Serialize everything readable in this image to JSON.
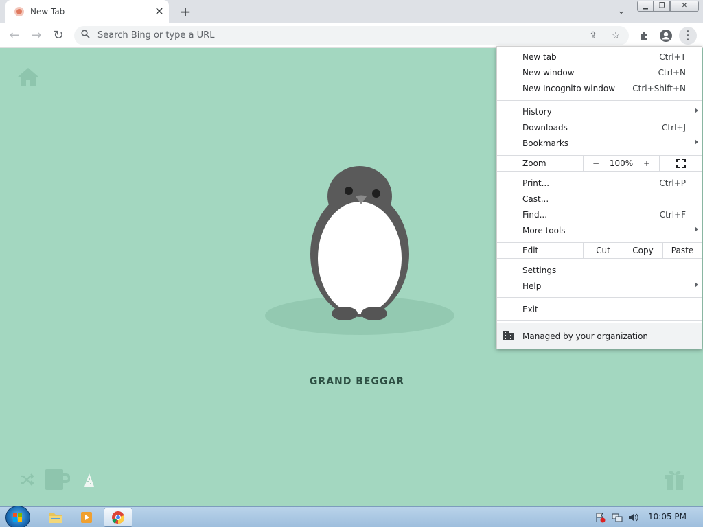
{
  "tab": {
    "title": "New Tab",
    "close": "✕"
  },
  "tabstrip": {
    "new_tab": "+",
    "search_tabs": "⌄"
  },
  "window": {
    "minimize": "▁",
    "maximize": "❐",
    "close": "✕"
  },
  "toolbar": {
    "back": "←",
    "forward": "→",
    "reload": "↻",
    "share": "⇪",
    "bookmark": "☆",
    "extensions": "✚",
    "menu": "⋮"
  },
  "omnibox": {
    "placeholder": "Search Bing or type a URL"
  },
  "ntp": {
    "caption": "GRAND BEGGAR"
  },
  "menu": {
    "new_tab": {
      "label": "New tab",
      "shortcut": "Ctrl+T"
    },
    "new_window": {
      "label": "New window",
      "shortcut": "Ctrl+N"
    },
    "incognito": {
      "label": "New Incognito window",
      "shortcut": "Ctrl+Shift+N"
    },
    "history": {
      "label": "History"
    },
    "downloads": {
      "label": "Downloads",
      "shortcut": "Ctrl+J"
    },
    "bookmarks": {
      "label": "Bookmarks"
    },
    "zoom": {
      "label": "Zoom",
      "minus": "−",
      "value": "100%",
      "plus": "+"
    },
    "print": {
      "label": "Print...",
      "shortcut": "Ctrl+P"
    },
    "cast": {
      "label": "Cast..."
    },
    "find": {
      "label": "Find...",
      "shortcut": "Ctrl+F"
    },
    "more_tools": {
      "label": "More tools"
    },
    "edit": {
      "label": "Edit",
      "cut": "Cut",
      "copy": "Copy",
      "paste": "Paste"
    },
    "settings": {
      "label": "Settings"
    },
    "help": {
      "label": "Help"
    },
    "exit": {
      "label": "Exit"
    },
    "managed": {
      "label": "Managed by your organization"
    }
  },
  "taskbar": {
    "clock": "10:05 PM"
  },
  "colors": {
    "page_background": "#a3d7c0",
    "caption": "#2d4f43",
    "penguin_body": "#5a5a5a",
    "penguin_belly": "#ffffff"
  }
}
